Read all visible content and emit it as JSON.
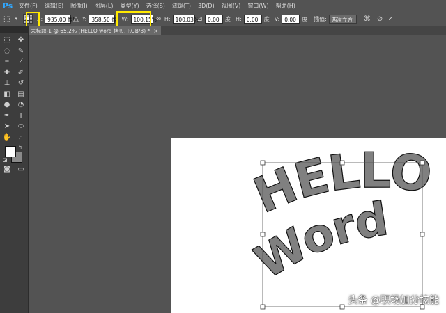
{
  "app": {
    "logo": "Ps",
    "menus": [
      "文件(F)",
      "编辑(E)",
      "图像(I)",
      "图层(L)",
      "类型(Y)",
      "选择(S)",
      "滤镜(T)",
      "3D(D)",
      "视图(V)",
      "窗口(W)",
      "帮助(H)"
    ]
  },
  "options": {
    "x_label": "X:",
    "x_value": "935.00 像!",
    "y_label": "Y:",
    "y_value": "358.50 像!",
    "w_label": "W:",
    "w_value": "100.15%",
    "h_label": "H:",
    "h_value": "100.03%",
    "angle_value": "0.00",
    "deg1": "度",
    "hskew_label": "H:",
    "hskew_value": "0.00",
    "deg2": "度",
    "vskew_label": "V:",
    "vskew_value": "0.00",
    "deg3": "度",
    "interp_label": "插值:",
    "interp_value": "两次立方"
  },
  "document": {
    "tab_label": "未标题-1 @ 65.2% (HELLO word 拷贝, RGB/8) *",
    "close_symbol": "×"
  },
  "canvas": {
    "text_line1": "HELLO",
    "text_line2": "Word",
    "text_color": "#808080"
  },
  "watermark": "头条 @职场加分技能",
  "colors": {
    "highlight": "#ffe900",
    "foreground": "#ffffff",
    "background": "#8a8a8a"
  }
}
